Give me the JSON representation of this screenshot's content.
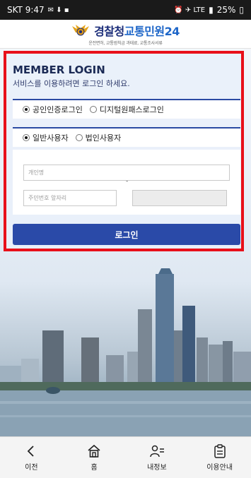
{
  "statusbar": {
    "carrier_time": "SKT 9:47",
    "left_icons": "✉ ⬇ ▪",
    "right_icons": "⏰ ✈ LTE",
    "battery": "25%"
  },
  "header": {
    "brand_police": "경찰청",
    "brand_service": "교통민원24",
    "tagline": "운전면허, 교통범칙금 과태료, 교통조사서류"
  },
  "login": {
    "title": "MEMBER LOGIN",
    "subtitle": "서비스를 이용하려면 로그인 하세요.",
    "auth_options": [
      {
        "label": "공인인증로그인",
        "selected": true
      },
      {
        "label": "디지털원패스로그인",
        "selected": false
      }
    ],
    "user_types": [
      {
        "label": "일반사용자",
        "selected": true
      },
      {
        "label": "법인사용자",
        "selected": false
      }
    ],
    "name_placeholder": "개인명",
    "rrn_front_placeholder": "주민번호 앞자리",
    "dash": "-",
    "button_label": "로그인"
  },
  "bottom_nav": [
    {
      "label": "이전",
      "icon": "back-icon"
    },
    {
      "label": "홈",
      "icon": "home-icon"
    },
    {
      "label": "내정보",
      "icon": "user-list-icon"
    },
    {
      "label": "이용안내",
      "icon": "clipboard-icon"
    }
  ],
  "colors": {
    "highlight": "#e8101a",
    "primary": "#2a4aa8",
    "title": "#1b2a55"
  }
}
